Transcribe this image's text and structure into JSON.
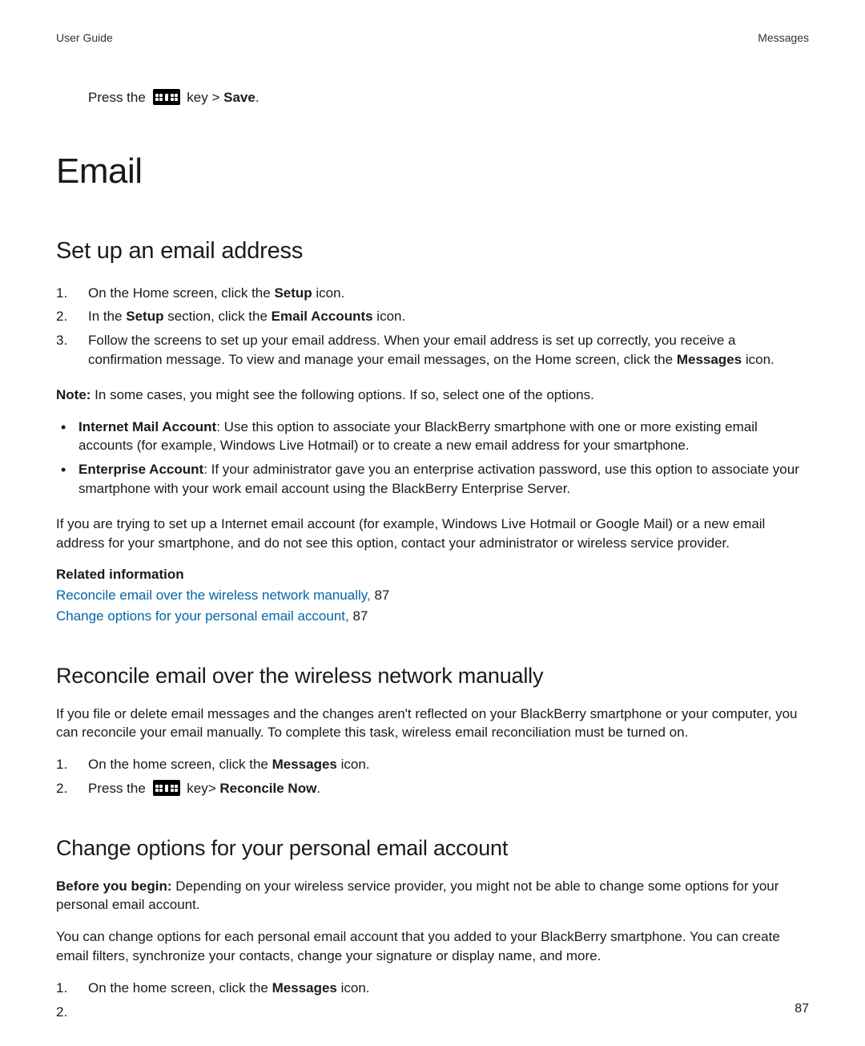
{
  "header": {
    "left": "User Guide",
    "right": "Messages"
  },
  "pressLine": {
    "prefix": "Press the ",
    "key_after": " key > ",
    "save": "Save",
    "period": "."
  },
  "chapterTitle": "Email",
  "section1": {
    "title": "Set up an email address",
    "steps": {
      "s1a": "On the Home screen, click the ",
      "s1b": "Setup",
      "s1c": " icon.",
      "s2a": "In the ",
      "s2b": "Setup",
      "s2c": " section, click the ",
      "s2d": "Email Accounts",
      "s2e": " icon.",
      "s3a": "Follow the screens to set up your email address. When your email address is set up correctly, you receive a confirmation message. To view and manage your email messages, on the Home screen, click the ",
      "s3b": "Messages",
      "s3c": " icon."
    },
    "note": {
      "label": "Note:",
      "text": " In some cases, you might see the following options. If so, select one of the options."
    },
    "bullets": {
      "b1a": "Internet Mail Account",
      "b1b": ": Use this option to associate your BlackBerry smartphone with one or more existing email accounts (for example, Windows Live Hotmail) or to create a new email address for your smartphone.",
      "b2a": "Enterprise Account",
      "b2b": ": If your administrator gave you an enterprise activation password, use this option to associate your smartphone with your work email account using the BlackBerry Enterprise Server."
    },
    "followup": "If you are trying to set up a Internet email account (for example, Windows Live Hotmail or Google Mail) or a new email address for your smartphone, and do not see this option, contact your administrator or wireless service provider.",
    "related": {
      "heading": "Related information",
      "link1": "Reconcile email over the wireless network manually,",
      "link1_pg": " 87",
      "link2": "Change options for your personal email account,",
      "link2_pg": " 87"
    }
  },
  "section2": {
    "title": "Reconcile email over the wireless network manually",
    "intro": "If you file or delete email messages and the changes aren't reflected on your BlackBerry smartphone or your computer, you can reconcile your email manually. To complete this task, wireless email reconciliation must be turned on.",
    "steps": {
      "s1a": "On the home screen, click the ",
      "s1b": "Messages",
      "s1c": " icon.",
      "s2a": "Press the ",
      "s2b": " key> ",
      "s2c": "Reconcile Now",
      "s2d": "."
    }
  },
  "section3": {
    "title": "Change options for your personal email account",
    "before": {
      "label": "Before you begin:",
      "text": " Depending on your wireless service provider, you might not be able to change some options for your personal email account."
    },
    "intro": "You can change options for each personal email account that you added to your BlackBerry smartphone. You can create email filters, synchronize your contacts, change your signature or display name, and more.",
    "steps": {
      "s1a": "On the home screen, click the ",
      "s1b": "Messages",
      "s1c": " icon."
    }
  },
  "pageNumber": "87",
  "icons": {
    "bbkey": "blackberry-menu-key-icon"
  }
}
